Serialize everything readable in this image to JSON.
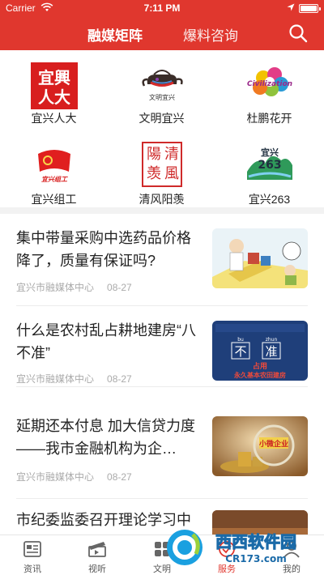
{
  "status_bar": {
    "carrier": "Carrier",
    "time": "7:11 PM"
  },
  "header": {
    "tabs": [
      {
        "label": "融媒矩阵"
      },
      {
        "label": "爆料咨询"
      }
    ],
    "colors": {
      "brand": "#e0372e"
    }
  },
  "grid": {
    "items": [
      {
        "label": "宜兴人大",
        "logo_text": "宜興人大",
        "icon": "yixing-rd-logo"
      },
      {
        "label": "文明宜兴",
        "logo_text": "文明宜兴",
        "icon": "teapot-logo"
      },
      {
        "label": "杜鹏花开",
        "logo_text": "Civilization",
        "icon": "civilization-logo"
      },
      {
        "label": "宜兴组工",
        "logo_text": "宜兴组工",
        "icon": "party-flag-logo"
      },
      {
        "label": "清风阳羡",
        "logo_text": "清風陽羡",
        "icon": "seal-logo"
      },
      {
        "label": "宜兴263",
        "logo_text": "宜兴263",
        "icon": "landscape-logo"
      }
    ]
  },
  "news": {
    "items": [
      {
        "title": "集中带量采购中选药品价格降了，质量有保证吗?",
        "source": "宜兴市融媒体中心",
        "date": "08-27",
        "thumb": "cartoon-illustration"
      },
      {
        "title": "什么是农村乱占耕地建房“八不准”",
        "source": "宜兴市融媒体中心",
        "date": "08-27",
        "thumb": "poster",
        "thumb_text": {
          "pinyin1": "bu",
          "pinyin2": "zhun",
          "chars1": "不",
          "chars2": "准",
          "line1": "占用",
          "line2": "永久基本农田建房"
        }
      },
      {
        "title": "延期还本付息 加大信贷力度——我市金融机构为企…",
        "source": "宜兴市融媒体中心",
        "date": "08-27",
        "thumb": "coins-photo",
        "thumb_text": {
          "sign": "小微企业"
        }
      },
      {
        "title": "市纪委监委召开理论学习中",
        "source": "",
        "date": "",
        "thumb": "photo"
      }
    ]
  },
  "tabbar": {
    "items": [
      {
        "label": "资讯",
        "icon": "news-icon"
      },
      {
        "label": "视听",
        "icon": "clapper-icon"
      },
      {
        "label": "文明",
        "icon": "grid-icon"
      },
      {
        "label": "服务",
        "icon": "service-icon"
      },
      {
        "label": "我的",
        "icon": "user-icon"
      }
    ],
    "active": "服务"
  },
  "watermark": {
    "brand": "西西软件园",
    "site": "CR173.com"
  }
}
